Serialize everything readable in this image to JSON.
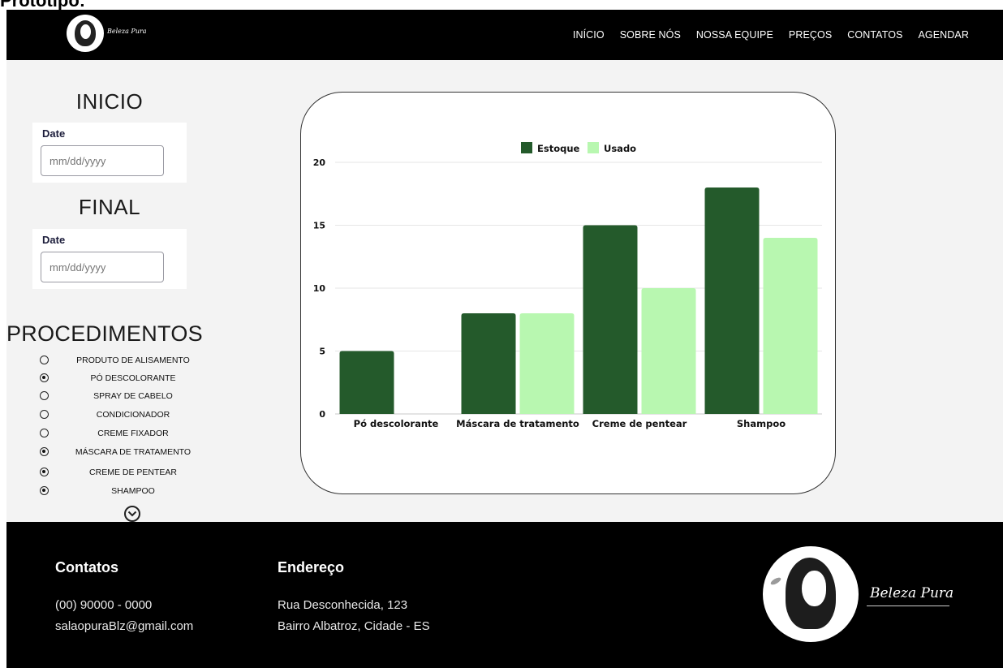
{
  "doc_title": "Protótipo:",
  "brand": {
    "name": "Beleza Pura"
  },
  "nav": [
    "INÍCIO",
    "SOBRE NÓS",
    "NOSSA EQUIPE",
    "PREÇOS",
    "CONTATOS",
    "AGENDAR"
  ],
  "filters": {
    "start": {
      "title": "INICIO",
      "label": "Date",
      "placeholder": "mm/dd/yyyy"
    },
    "end": {
      "title": "FINAL",
      "label": "Date",
      "placeholder": "mm/dd/yyyy"
    }
  },
  "procedures": {
    "title": "PROCEDIMENTOS",
    "items": [
      {
        "label": "PRODUTO DE ALISAMENTO",
        "selected": false
      },
      {
        "label": "PÓ DESCOLORANTE",
        "selected": true
      },
      {
        "label": "SPRAY DE CABELO",
        "selected": false
      },
      {
        "label": "CONDICIONADOR",
        "selected": false
      },
      {
        "label": "CREME FIXADOR",
        "selected": false
      },
      {
        "label": "MÁSCARA DE TRATAMENTO",
        "selected": true
      },
      {
        "label": "CREME DE PENTEAR",
        "selected": true
      },
      {
        "label": "SHAMPOO",
        "selected": true
      }
    ],
    "expand_icon": "chevron-down-circle-icon"
  },
  "chart_data": {
    "type": "bar",
    "categories": [
      "Pó descolorante",
      "Máscara de tratamento",
      "Creme de pentear",
      "Shampoo"
    ],
    "series": [
      {
        "name": "Estoque",
        "values": [
          5,
          8,
          15,
          18
        ],
        "color": "#245a2b"
      },
      {
        "name": "Usado",
        "values": [
          0,
          8,
          10,
          14
        ],
        "color": "#b8f7b0"
      }
    ],
    "yticks": [
      0,
      5,
      10,
      15,
      20
    ],
    "ylim": [
      0,
      20
    ],
    "grid": true,
    "legend": "top-center"
  },
  "footer": {
    "contacts": {
      "title": "Contatos",
      "phone": "(00) 90000 - 0000",
      "email": "salaopuraBlz@gmail.com"
    },
    "address": {
      "title": "Endereço",
      "street": "Rua Desconhecida, 123",
      "city": "Bairro Albatroz, Cidade - ES"
    }
  }
}
